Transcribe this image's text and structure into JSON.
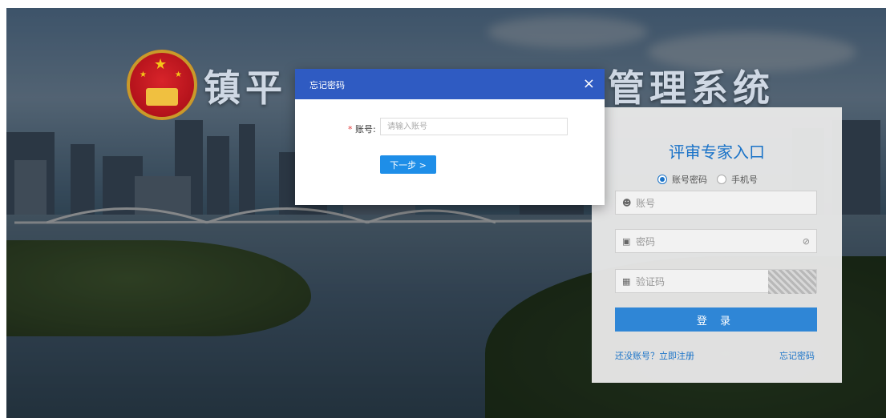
{
  "system_title": {
    "left": "镇平",
    "right": "管理系统"
  },
  "login": {
    "heading": "评审专家入口",
    "login_type_options": [
      "账号密码",
      "手机号"
    ],
    "selected_login_type": "账号密码",
    "account_placeholder": "账号",
    "password_placeholder": "密码",
    "captcha_placeholder": "验证码",
    "submit_label": "登 录",
    "register_link": "还没账号？立即注册",
    "forgot_link": "忘记密码"
  },
  "forgot_modal": {
    "title": "忘记密码",
    "close_glyph": "×",
    "required_mark": "*",
    "account_label": "账号:",
    "account_placeholder": "请输入账号",
    "next_label": "下一步 >"
  },
  "colors": {
    "accent": "#2f86d6",
    "modal_header": "#2f5bc2",
    "heading_blue": "#1a73c8",
    "required_red": "#e03b3b"
  },
  "icons": {
    "account": "user-icon",
    "password": "lock-icon",
    "captcha": "image-icon",
    "show_password": "eye-off-icon",
    "close": "close-icon"
  }
}
